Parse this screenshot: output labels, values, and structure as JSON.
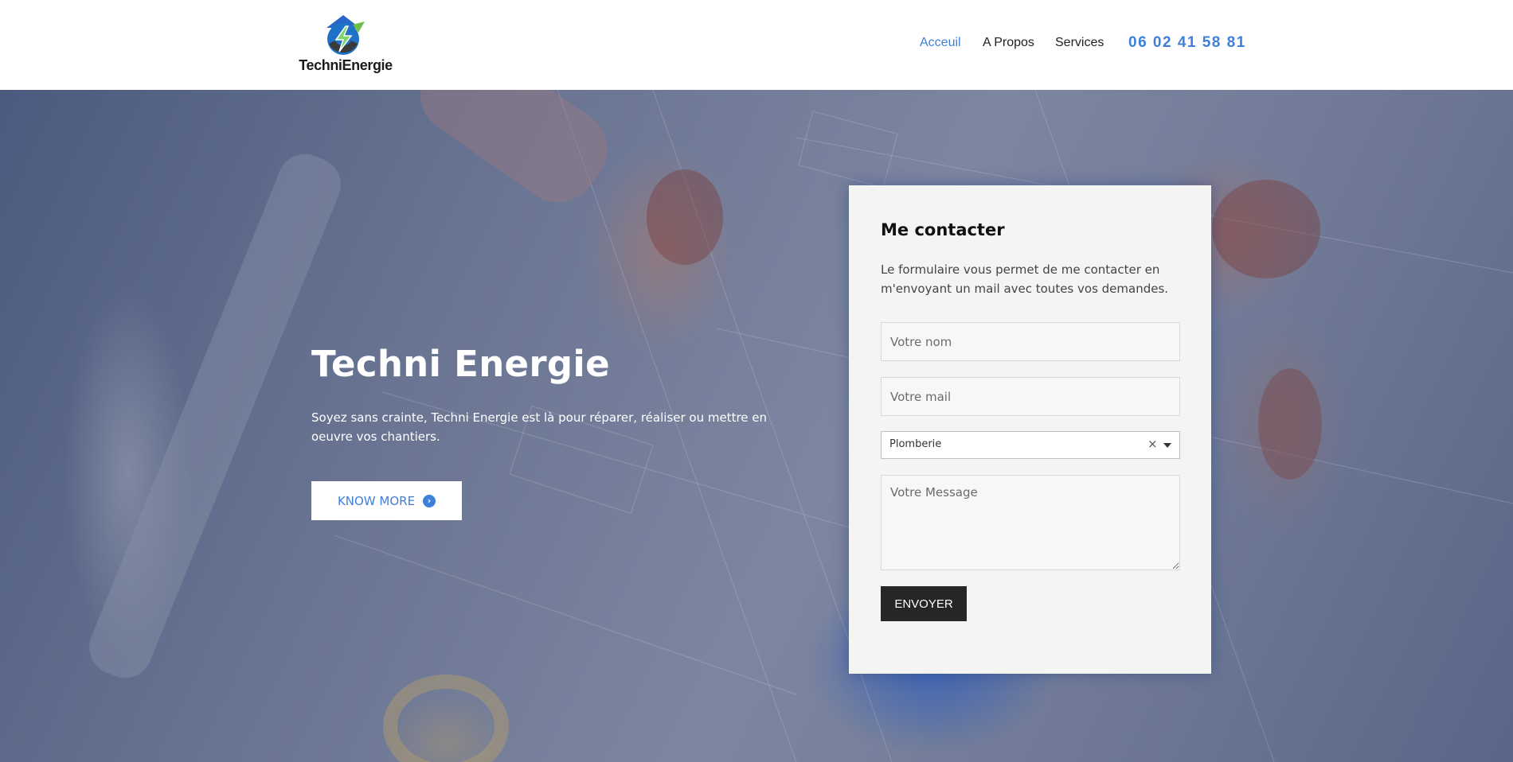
{
  "header": {
    "logo_text": "TechniEnergie",
    "nav": [
      {
        "label": "Acceuil",
        "active": true
      },
      {
        "label": "A Propos",
        "active": false
      },
      {
        "label": "Services",
        "active": false
      }
    ],
    "phone": "06 02 41 58 81"
  },
  "hero": {
    "title": "Techni Energie",
    "subtitle": "Soyez sans crainte, Techni Energie est là pour réparer, réaliser ou mettre en oeuvre vos chantiers.",
    "cta_label": "KNOW MORE",
    "cta_icon": "chevron-circle-right-icon"
  },
  "contact": {
    "title": "Me contacter",
    "description": "Le formulaire vous permet de me contacter en m'envoyant un mail avec toutes vos demandes.",
    "name_placeholder": "Votre nom",
    "mail_placeholder": "Votre mail",
    "service_selected": "Plomberie",
    "message_placeholder": "Votre Message",
    "submit_label": "ENVOYER"
  },
  "colors": {
    "accent": "#3e7fdc",
    "submit_bg": "#262626",
    "card_bg": "#f4f5f3"
  }
}
